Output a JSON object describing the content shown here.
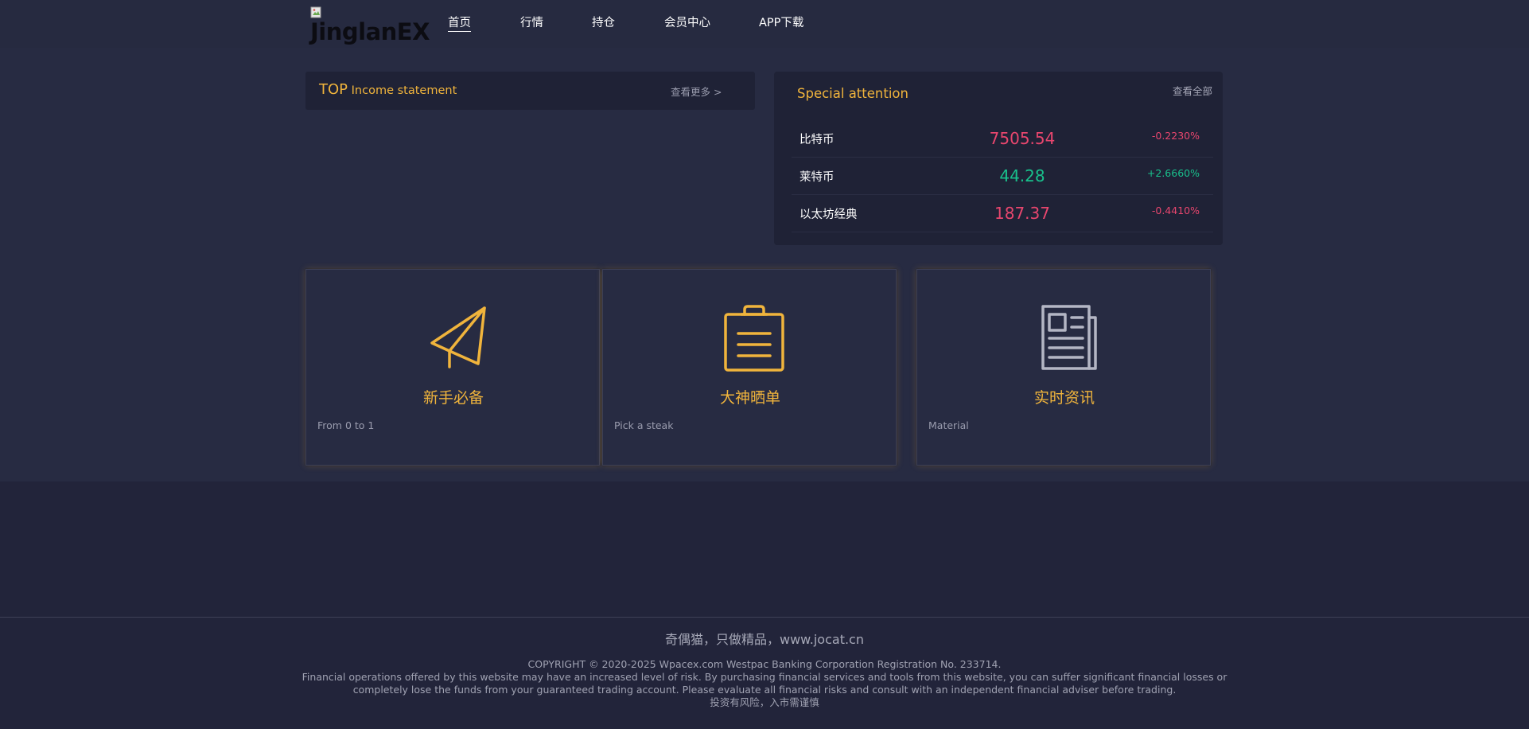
{
  "header": {
    "logo_text": "JinglanEX",
    "nav": [
      {
        "label": "首页"
      },
      {
        "label": "行情"
      },
      {
        "label": "持仓"
      },
      {
        "label": "会员中心"
      },
      {
        "label": "APP下载"
      }
    ]
  },
  "top_panel": {
    "title_big": "TOP",
    "title_rest": "Income statement",
    "more_label": "查看更多 >"
  },
  "special_attention": {
    "title": "Special attention",
    "view_all_label": "查看全部",
    "rows": [
      {
        "coin": "比特币",
        "price": "7505.54",
        "change": "-0.2230%",
        "direction": "down"
      },
      {
        "coin": "莱特币",
        "price": "44.28",
        "change": "+2.6660%",
        "direction": "up"
      },
      {
        "coin": "以太坊经典",
        "price": "187.37",
        "change": "-0.4410%",
        "direction": "down"
      }
    ]
  },
  "cards": [
    {
      "icon": "paper-plane-icon",
      "title": "新手必备",
      "subtitle": "From 0 to 1"
    },
    {
      "icon": "clipboard-icon",
      "title": "大神晒单",
      "subtitle": "Pick a steak"
    },
    {
      "icon": "newspaper-icon",
      "title": "实时资讯",
      "subtitle": "Material"
    }
  ],
  "footer": {
    "slogan": "奇偶猫，只做精品，www.jocat.cn",
    "copyright": "COPYRIGHT © 2020-2025 Wpacex.com Westpac Banking Corporation Registration No. 233714.",
    "disclaimer_line1": "Financial operations offered by this website may have an increased level of risk. By purchasing financial services and tools from this website, you can suffer significant financial losses or",
    "disclaimer_line2": "completely lose the funds from your guaranteed trading account. Please evaluate all financial risks and consult with an independent financial adviser before trading.",
    "risk_notice": "投资有风险，入市需谨慎"
  },
  "colors": {
    "accent": "#f0b43c",
    "up": "#19c08c",
    "down": "#e8466e",
    "background": "#22243a",
    "panel": "#1f2236"
  }
}
